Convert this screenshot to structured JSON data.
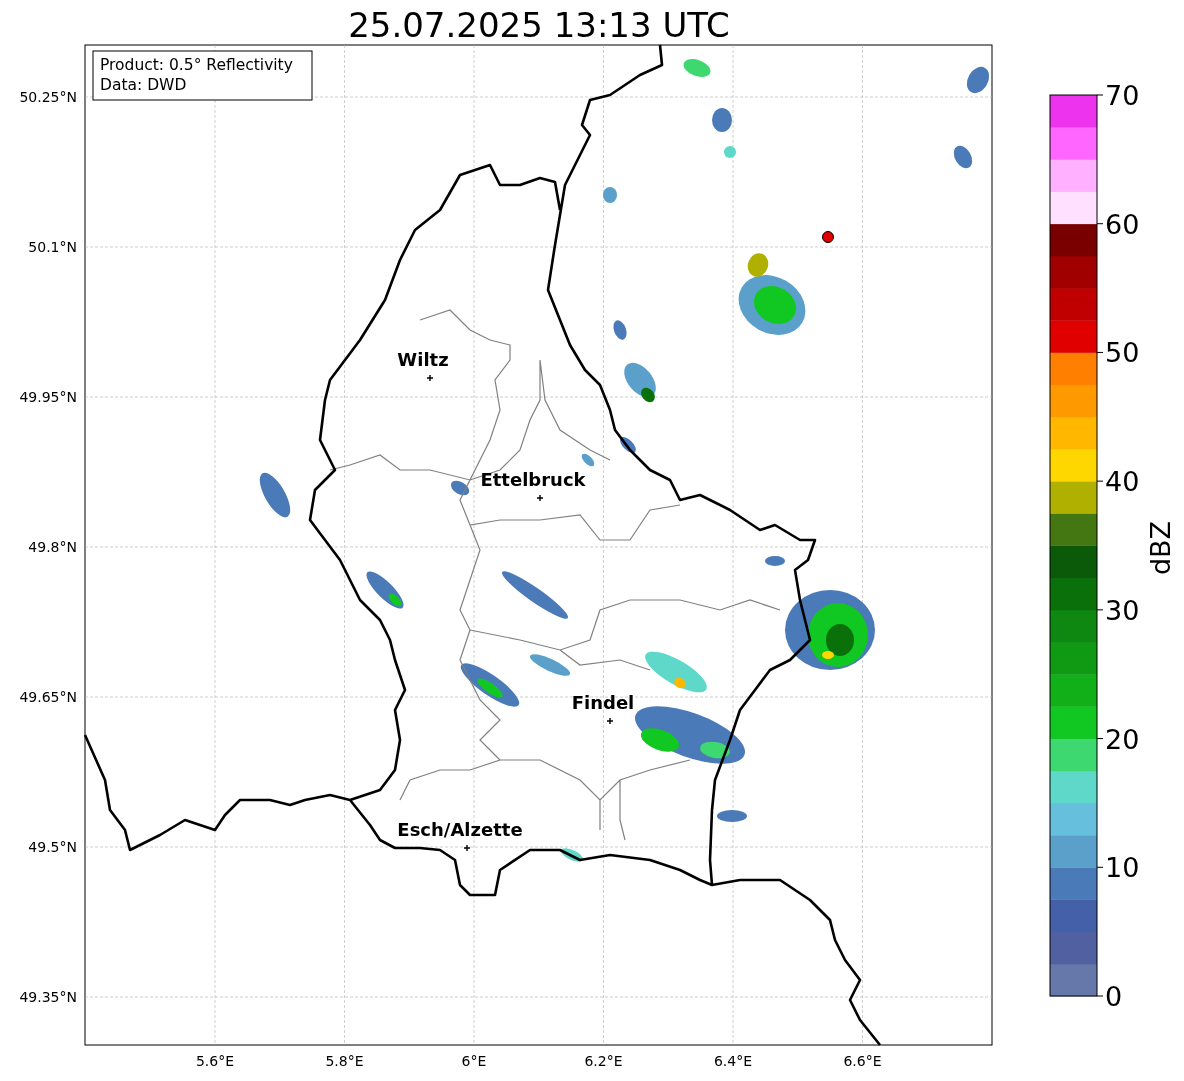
{
  "title": "25.07.2025 13:13 UTC",
  "info_box": [
    "Product: 0.5° Reflectivity",
    "Data: DWD"
  ],
  "map": {
    "y_tick_labels": [
      "50.25°N",
      "50.1°N",
      "49.95°N",
      "49.8°N",
      "49.65°N",
      "49.5°N",
      "49.35°N"
    ],
    "x_tick_labels": [
      "5.6°E",
      "5.8°E",
      "6°E",
      "6.2°E",
      "6.4°E",
      "6.6°E"
    ],
    "cities": [
      {
        "name": "Wiltz"
      },
      {
        "name": "Ettelbruck"
      },
      {
        "name": "Findel"
      },
      {
        "name": "Esch/Alzette"
      }
    ]
  },
  "colorbar": {
    "label": "dBZ",
    "tick_labels": [
      "70",
      "60",
      "50",
      "40",
      "30",
      "20",
      "10",
      "0"
    ],
    "bands": [
      {
        "color": "#6677aa"
      },
      {
        "color": "#5060a0"
      },
      {
        "color": "#4460a8"
      },
      {
        "color": "#4a7ab8"
      },
      {
        "color": "#5aa0ca"
      },
      {
        "color": "#66c0dd"
      },
      {
        "color": "#5ed8c8"
      },
      {
        "color": "#3ed870"
      },
      {
        "color": "#11c822"
      },
      {
        "color": "#12b018"
      },
      {
        "color": "#109a14"
      },
      {
        "color": "#0f8812"
      },
      {
        "color": "#0a700a"
      },
      {
        "color": "#0a5a0a"
      },
      {
        "color": "#447711"
      },
      {
        "color": "#b0b000"
      },
      {
        "color": "#ffd700"
      },
      {
        "color": "#ffb700"
      },
      {
        "color": "#ff9900"
      },
      {
        "color": "#ff7f00"
      },
      {
        "color": "#e00000"
      },
      {
        "color": "#c00000"
      },
      {
        "color": "#a00000"
      },
      {
        "color": "#7a0000"
      },
      {
        "color": "#ffe0ff"
      },
      {
        "color": "#ffb0ff"
      },
      {
        "color": "#ff66ff"
      },
      {
        "color": "#ee33ee"
      }
    ]
  }
}
